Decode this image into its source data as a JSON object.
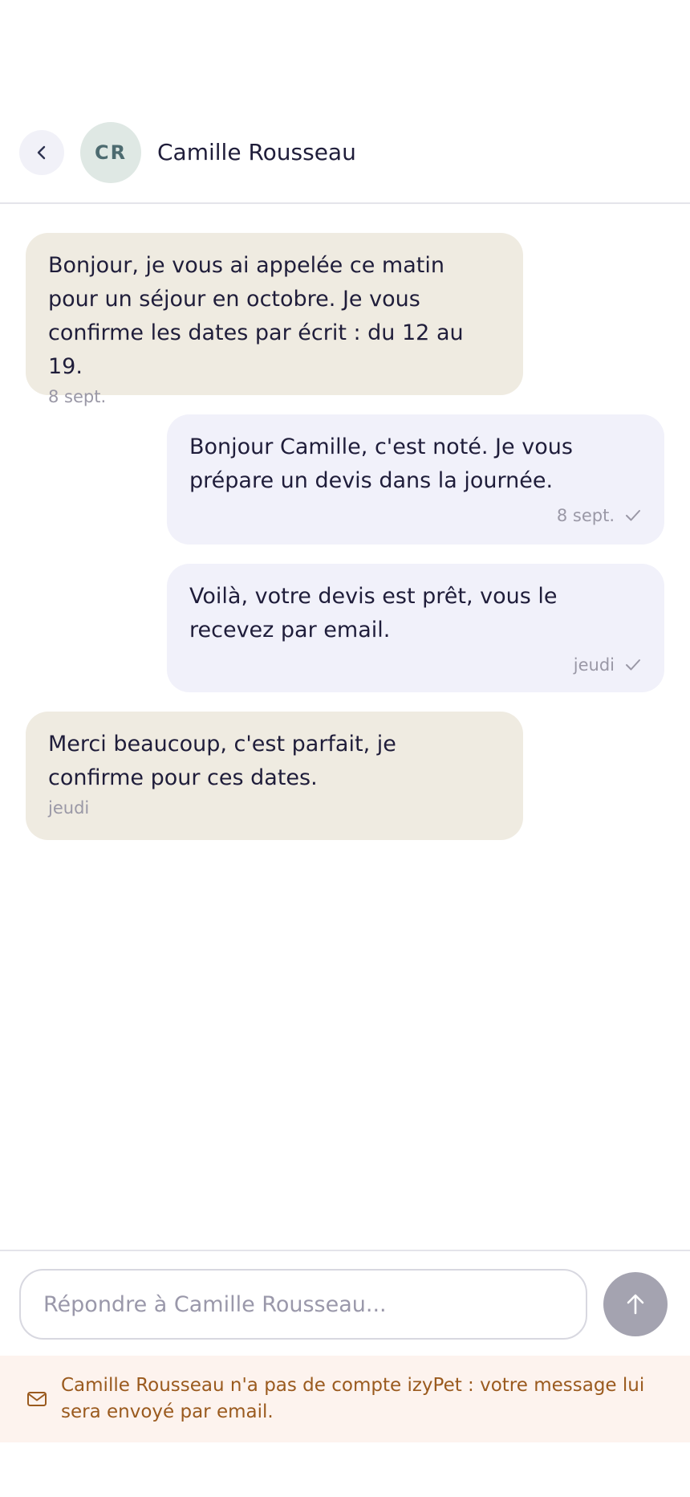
{
  "header": {
    "avatar_initials": "CR",
    "contact_name": "Camille Rousseau",
    "back_icon": "chevron-left-icon"
  },
  "messages": [
    {
      "direction": "incoming",
      "text": "Bonjour, je vous ai appelée ce matin\npour un séjour en octobre. Je vous\nconfirme les dates par écrit : du 12 au 19.",
      "time": "8 sept."
    },
    {
      "direction": "outgoing",
      "text": "Bonjour Camille, c'est noté. Je vous\nprépare un devis dans la journée.",
      "time": "8 sept.",
      "status_icon": "check-icon"
    },
    {
      "direction": "outgoing",
      "text": "Voilà, votre devis est prêt, vous le\nrecevez par email.",
      "time": "jeudi",
      "status_icon": "check-icon"
    },
    {
      "direction": "incoming",
      "text": "Merci beaucoup, c'est parfait, je\nconfirme pour ces dates.",
      "time": "jeudi"
    }
  ],
  "composer": {
    "value": "",
    "placeholder": "Répondre à Camille Rousseau...",
    "send_icon": "arrow-up-icon"
  },
  "notice": {
    "icon": "mail-icon",
    "text": "Camille Rousseau n'a pas de compte izyPet : votre message lui sera envoyé par email."
  },
  "colors": {
    "incoming_bubble": "#efebe1",
    "outgoing_bubble": "#f1f1fa",
    "send_button": "#a4a3b0",
    "notice_background": "#fdf3ee",
    "notice_text": "#9a5a1e",
    "avatar_background": "#dfe8e4"
  }
}
